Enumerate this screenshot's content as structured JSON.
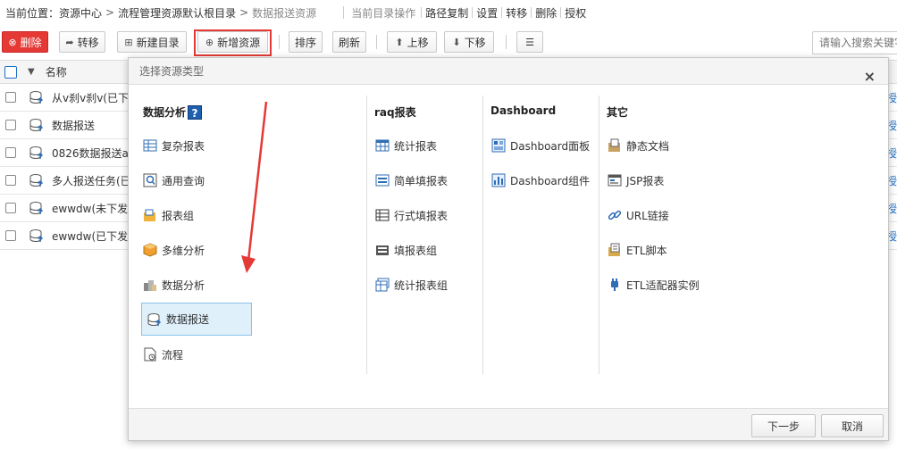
{
  "breadcrumb": {
    "prefix": "当前位置：",
    "items": [
      "资源中心",
      "流程管理资源默认根目录",
      "数据报送资源"
    ],
    "separator": ">"
  },
  "dir_ops": {
    "title": "当前目录操作",
    "items": [
      "路径复制",
      "设置",
      "转移",
      "删除",
      "授权"
    ]
  },
  "toolbar": {
    "delete": "删除",
    "move": "转移",
    "new_dir": "新建目录",
    "new_resource": "新增资源",
    "sort": "排序",
    "refresh": "刷新",
    "up": "上移",
    "down": "下移",
    "menu": "☰",
    "search_placeholder": "请输入搜索关键字"
  },
  "grid": {
    "col_name": "名称",
    "rows": [
      {
        "name": "从v刹v刹v(已下发",
        "link": "授"
      },
      {
        "name": "数据报送",
        "link": "授"
      },
      {
        "name": "0826数据报送a",
        "link": "授"
      },
      {
        "name": "多人报送任务(已",
        "link": "授"
      },
      {
        "name": "ewwdw(未下发",
        "link": "授"
      },
      {
        "name": "ewwdw(已下发",
        "link": "授"
      }
    ]
  },
  "modal": {
    "title": "选择资源类型",
    "close": "×",
    "columns": [
      {
        "heading": "数据分析",
        "help": "?",
        "items": [
          "复杂报表",
          "通用查询",
          "报表组",
          "多维分析",
          "数据分析",
          "数据报送",
          "流程"
        ],
        "selected_index": 5
      },
      {
        "heading": "raq报表",
        "items": [
          "统计报表",
          "简单填报表",
          "行式填报表",
          "填报表组",
          "统计报表组"
        ]
      },
      {
        "heading": "Dashboard",
        "items": [
          "Dashboard面板",
          "Dashboard组件"
        ]
      },
      {
        "heading": "其它",
        "items": [
          "静态文档",
          "JSP报表",
          "URL链接",
          "ETL脚本",
          "ETL适配器实例"
        ]
      }
    ],
    "next": "下一步",
    "cancel": "取消"
  },
  "colors": {
    "danger": "#e53935",
    "accent_blue": "#1f6fc5",
    "selected_bg": "#dff0fb",
    "annotation_red": "#e53935"
  }
}
